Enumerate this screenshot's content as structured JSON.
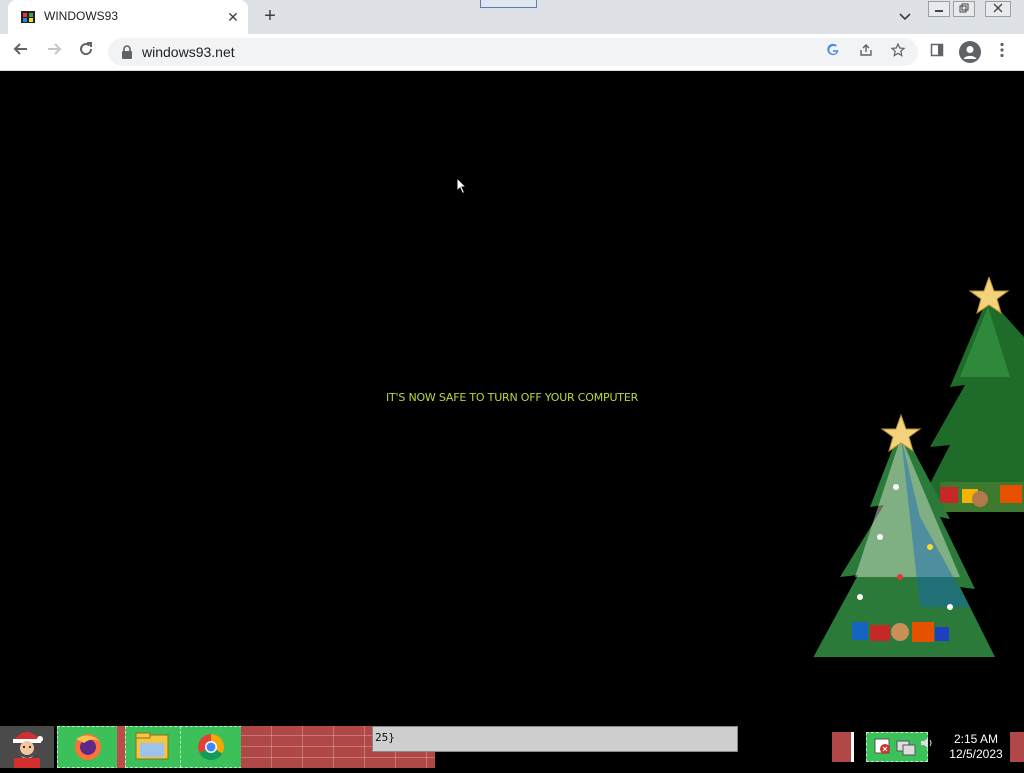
{
  "browser": {
    "tab": {
      "title": "WINDOWS93",
      "close_glyph": "✕"
    },
    "new_tab_glyph": "+",
    "tab_search_glyph": "⌄",
    "window_controls": {
      "minimize": "▭",
      "restore": "❐",
      "close": "✕"
    },
    "nav": {
      "back": "←",
      "forward": "→",
      "reload": "↻"
    },
    "address": {
      "url": "windows93.net"
    },
    "omnibox_icons": [
      "google-icon",
      "share-icon",
      "bookmark-star-icon"
    ],
    "toolbar_icons": [
      "side-panel-icon",
      "profile-icon",
      "menu-icon"
    ]
  },
  "page": {
    "message": "IT'S NOW SAFE TO TURN OFF YOUR COMPUTER",
    "message_color": "#b8d83a",
    "background": "#000000"
  },
  "taskbar": {
    "start_icon": "santa-icon",
    "apps": [
      {
        "name": "firefox-icon"
      },
      {
        "name": "file-manager-icon"
      },
      {
        "name": "chrome-icon"
      }
    ],
    "entry_text": "25}",
    "tray": {
      "volume_glyph": "🔊",
      "time": "2:15 AM",
      "date": "12/5/2023"
    }
  },
  "colors": {
    "taskbar_green": "#3cc15a",
    "taskbar_red": "#b04848",
    "chrome_tabstrip": "#dee1e6"
  }
}
